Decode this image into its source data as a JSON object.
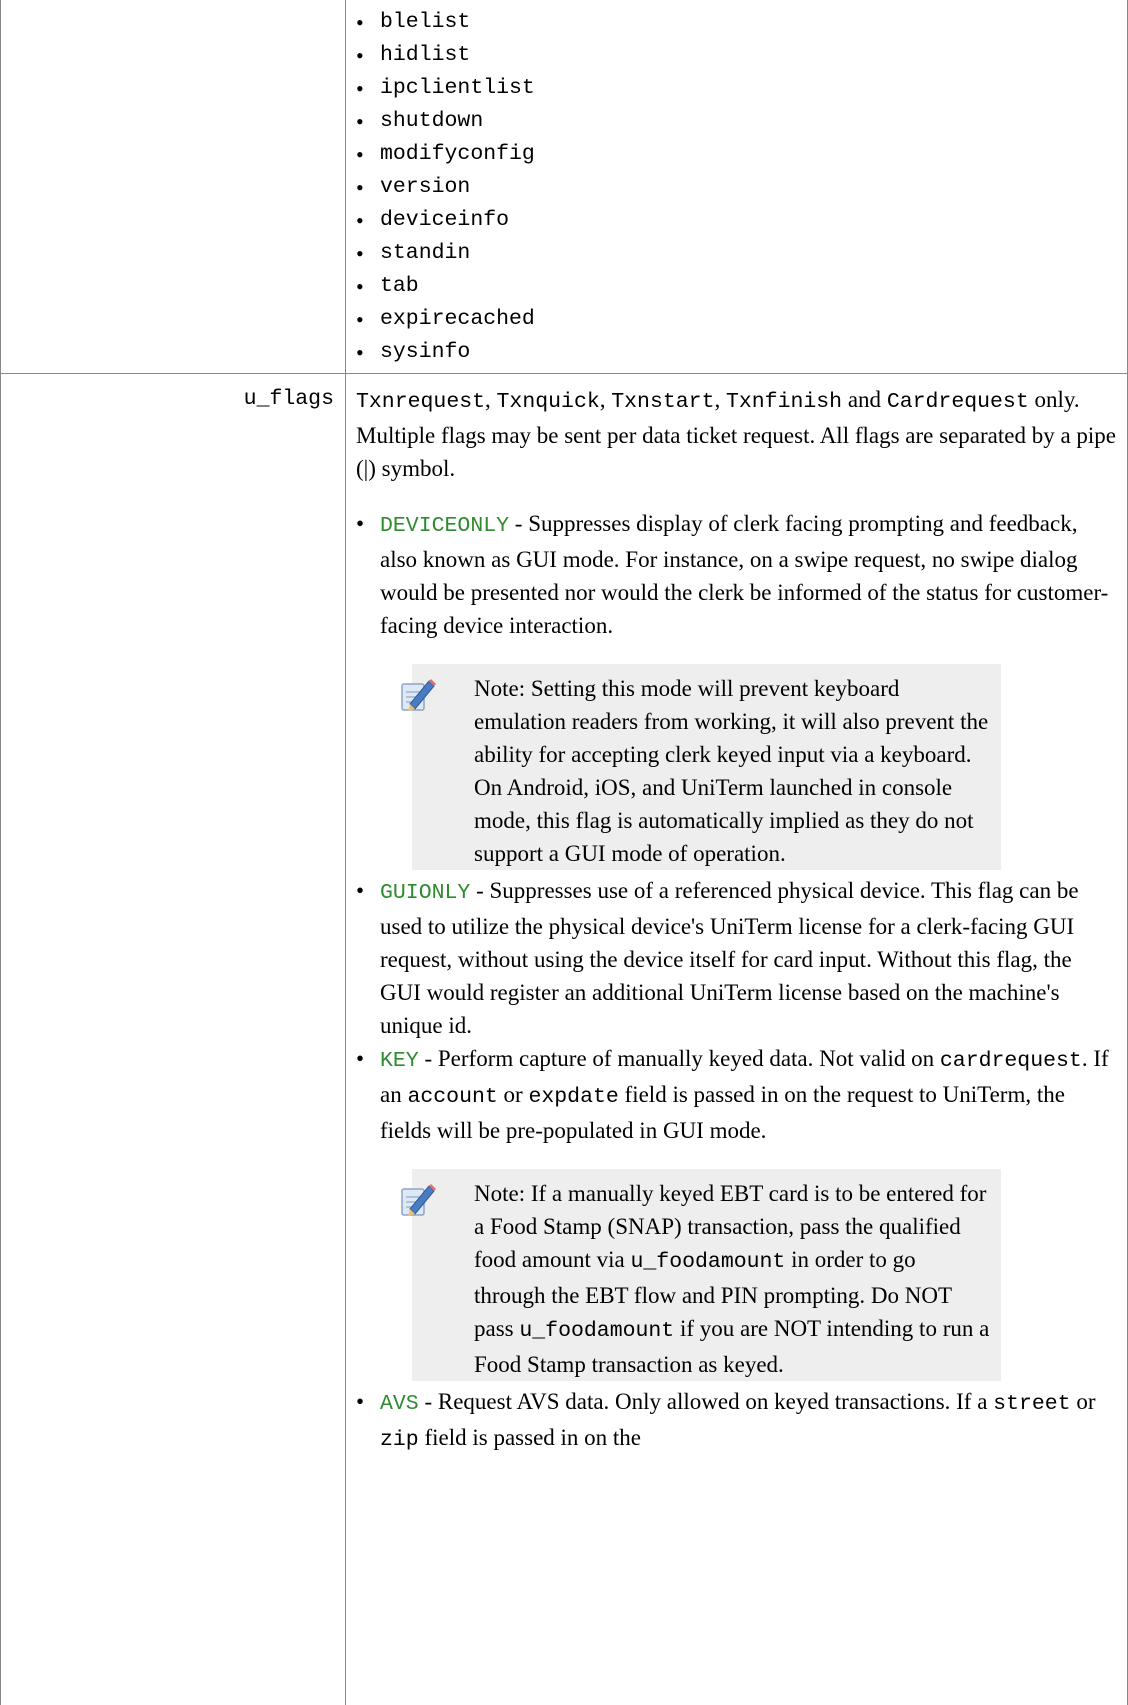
{
  "commands": [
    "blelist",
    "hidlist",
    "ipclientlist",
    "shutdown",
    "modifyconfig",
    "version",
    "deviceinfo",
    "standin",
    "tab",
    "expirecached",
    "sysinfo"
  ],
  "param": {
    "name": "u_flags",
    "intro": {
      "c1": "Txnrequest",
      "s1": ", ",
      "c2": "Txnquick",
      "s2": ", ",
      "c3": "Txnstart",
      "s3": ", ",
      "c4": "Txnfinish",
      "s4": " and ",
      "c5": "Cardrequest",
      "s5": " only. Multiple flags may be sent per data ticket request. All flags are separated by a pipe (|) symbol."
    },
    "flags": {
      "deviceonly": {
        "name": "DEVICEONLY",
        "desc": " - Suppresses display of clerk facing prompting and feedback, also known as GUI mode. For instance, on a swipe request, no swipe dialog would be presented nor would the clerk be informed of the status for customer-facing device interaction.",
        "note": "Note: Setting this mode will prevent keyboard emulation readers from working, it will also prevent the ability for accepting clerk keyed input via a keyboard. On Android, iOS, and UniTerm launched in console mode, this flag is automatically implied as they do not support a GUI mode of operation."
      },
      "guionly": {
        "name": "GUIONLY",
        "desc": " - Suppresses use of a referenced physical device. This flag can be used to utilize the physical device's UniTerm license for a clerk-facing GUI request, without using the device itself for card input. Without this flag, the GUI would register an additional UniTerm license based on the machine's unique id."
      },
      "key": {
        "name": "KEY",
        "d1": " - Perform capture of manually keyed data. Not valid on ",
        "c1": "cardrequest",
        "d2": ". If an ",
        "c2": "account",
        "d3": " or ",
        "c3": "expdate",
        "d4": " field is passed in on the request to UniTerm, the fields will be pre-populated in GUI mode.",
        "note": {
          "t1": "Note: If a manually keyed EBT card is to be entered for a Food Stamp (SNAP) transaction, pass the qualified food amount via ",
          "c1": "u_foodamount",
          "t2": " in order to go through the EBT flow and PIN prompting. Do NOT pass ",
          "c2": "u_foodamount",
          "t3": " if you are NOT intending to run a Food Stamp transaction as keyed."
        }
      },
      "avs": {
        "name": "AVS",
        "d1": " - Request AVS data. Only allowed on keyed transactions. If a ",
        "c1": "street",
        "d2": " or ",
        "c2": "zip",
        "d3": " field is passed in on the"
      }
    }
  }
}
